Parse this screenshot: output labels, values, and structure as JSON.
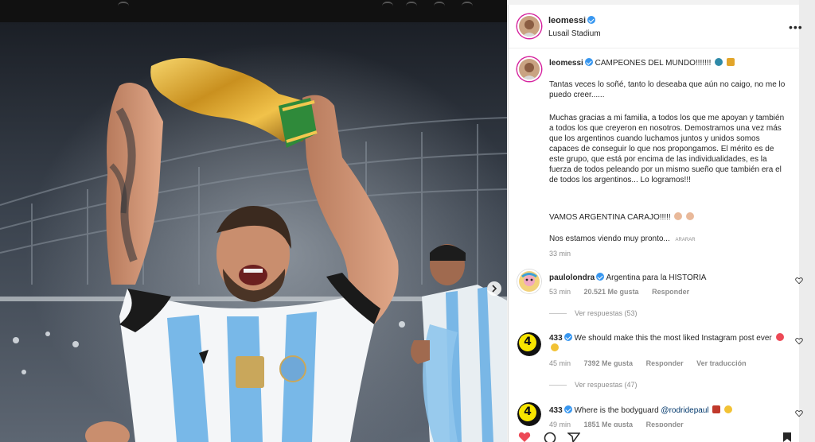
{
  "post": {
    "username": "leomessi",
    "location": "Lusail Stadium",
    "caption_title": "CAMPEONES DEL MUNDO!!!!!!!",
    "caption_p1": "Tantas veces lo soñé, tanto lo deseaba que aún no caigo, no me lo puedo creer......",
    "caption_p2": "Muchas gracias a mi familia, a todos los que me apoyan y también a todos los que creyeron en nosotros. Demostramos una vez más que los argentinos cuando luchamos juntos y unidos somos capaces de conseguir lo que nos propongamos. El mérito es de este grupo, que está por encima de las individualidades, es la fuerza de todos peleando por un mismo sueño que también era el de todos los argentinos... Lo logramos!!!",
    "caption_p3": "VAMOS ARGENTINA CARAJO!!!!!",
    "caption_p4": "Nos estamos viendo muy pronto...",
    "caption_tag": "ARARAR",
    "time": "33 min",
    "more_label": "•••"
  },
  "comments": [
    {
      "username": "paulolondra",
      "text": "Argentina para la HISTORIA",
      "time": "53 min",
      "likes": "20.521 Me gusta",
      "reply": "Responder",
      "view_replies": "Ver respuestas (53)"
    },
    {
      "username": "433",
      "text": "We should make this the most liked Instagram post ever",
      "time": "45 min",
      "likes": "7392 Me gusta",
      "reply": "Responder",
      "translate": "Ver traducción",
      "view_replies": "Ver respuestas (47)"
    },
    {
      "username": "433",
      "text_pre": "Where is the bodyguard ",
      "mention": "@rodridepaul",
      "time": "49 min",
      "likes": "1851 Me gusta",
      "reply": "Responder"
    }
  ],
  "badge_433": "4",
  "colors": {
    "verified": "#3897f0",
    "text": "#262626",
    "muted": "#8e8e8e",
    "badge_yellow": "#f7e500",
    "like_red": "#ed4956"
  },
  "icons": [
    "verified-icon",
    "heart-icon",
    "comment-icon",
    "share-icon",
    "bookmark-icon",
    "more-icon",
    "next-arrow-icon"
  ]
}
